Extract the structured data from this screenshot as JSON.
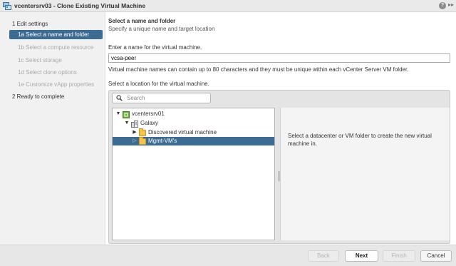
{
  "window": {
    "title": "vcentersrv03 - Clone Existing Virtual Machine",
    "help_glyph": "?",
    "expand_glyph": "▸▸"
  },
  "sidebar": {
    "steps": [
      {
        "label": "1  Edit settings",
        "level": "top",
        "state": "normal"
      },
      {
        "label": "1a  Select a name and folder",
        "level": "sub",
        "state": "active"
      },
      {
        "label": "1b  Select a compute resource",
        "level": "sub",
        "state": "disabled"
      },
      {
        "label": "1c  Select storage",
        "level": "sub",
        "state": "disabled"
      },
      {
        "label": "1d  Select clone options",
        "level": "sub",
        "state": "disabled"
      },
      {
        "label": "1e  Customize vApp properties",
        "level": "sub",
        "state": "disabled"
      },
      {
        "label": "2  Ready to complete",
        "level": "top",
        "state": "normal"
      }
    ]
  },
  "main": {
    "heading": "Select a name and folder",
    "subheading": "Specify a unique name and target location",
    "name_label": "Enter a name for the virtual machine.",
    "name_value": "vcsa-peer",
    "name_hint": "Virtual machine names can contain up to 80 characters and they must be unique within each vCenter Server VM folder.",
    "location_label": "Select a location for the virtual machine.",
    "search_placeholder": "Search",
    "tree": [
      {
        "label": "vcentersrv01",
        "icon": "vcenter-icon",
        "twisty": "▼",
        "depth": 0,
        "selected": false
      },
      {
        "label": "Galaxy",
        "icon": "datacenter-icon",
        "twisty": "▼",
        "depth": 1,
        "selected": false
      },
      {
        "label": "Discovered virtual machine",
        "icon": "folder-icon",
        "twisty": "▶",
        "depth": 2,
        "selected": false
      },
      {
        "label": "Mgmt-VM's",
        "icon": "folder-icon",
        "twisty": "▷",
        "depth": 2,
        "selected": true
      }
    ],
    "right_message": "Select a datacenter or VM folder to create the new virtual machine in."
  },
  "footer": {
    "back_label": "Back",
    "next_label": "Next",
    "finish_label": "Finish",
    "cancel_label": "Cancel"
  },
  "colors": {
    "accent": "#3c6c93",
    "folder": "#f5c448",
    "vcenter_green": "#6fb33f"
  }
}
